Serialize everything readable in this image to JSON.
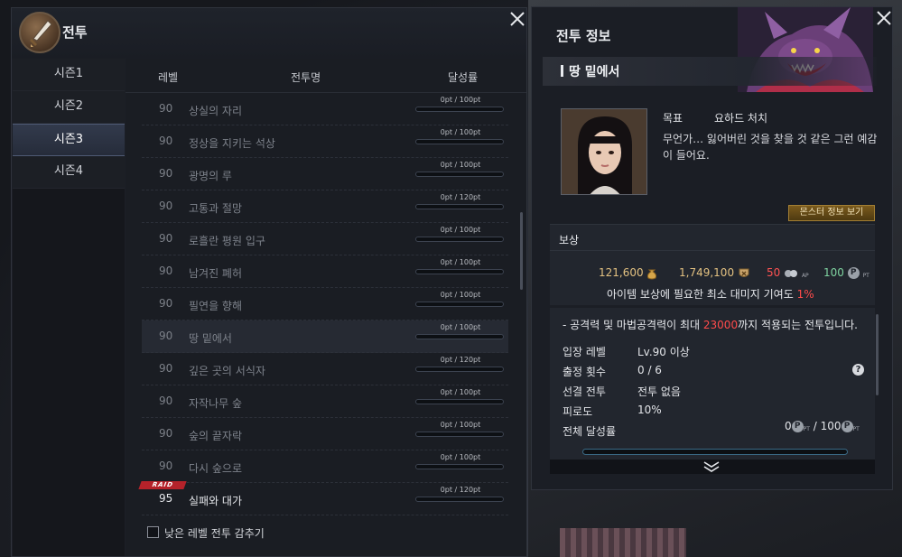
{
  "left_window": {
    "title": "전투",
    "seasons": [
      "시즌1",
      "시즌2",
      "시즌3",
      "시즌4"
    ],
    "active_season_index": 2,
    "columns": {
      "level": "레벨",
      "name": "전투명",
      "achievement": "달성률"
    },
    "rows": [
      {
        "level": "90",
        "name": "상실의 자리",
        "points": "0pt / 100pt",
        "progress": 0
      },
      {
        "level": "90",
        "name": "정상을 지키는 석상",
        "points": "0pt / 100pt",
        "progress": 0
      },
      {
        "level": "90",
        "name": "광명의 루",
        "points": "0pt / 100pt",
        "progress": 0
      },
      {
        "level": "90",
        "name": "고통과 절망",
        "points": "0pt / 120pt",
        "progress": 0
      },
      {
        "level": "90",
        "name": "로흘란 평원 입구",
        "points": "0pt / 100pt",
        "progress": 0
      },
      {
        "level": "90",
        "name": "남겨진 폐허",
        "points": "0pt / 100pt",
        "progress": 0
      },
      {
        "level": "90",
        "name": "필연을 향해",
        "points": "0pt / 100pt",
        "progress": 0
      },
      {
        "level": "90",
        "name": "땅 밑에서",
        "points": "0pt / 100pt",
        "progress": 0
      },
      {
        "level": "90",
        "name": "깊은 곳의 서식자",
        "points": "0pt / 120pt",
        "progress": 0
      },
      {
        "level": "90",
        "name": "자작나무 숲",
        "points": "0pt / 100pt",
        "progress": 0
      },
      {
        "level": "90",
        "name": "숲의 끝자락",
        "points": "0pt / 100pt",
        "progress": 0
      },
      {
        "level": "90",
        "name": "다시 숲으로",
        "points": "0pt / 100pt",
        "progress": 0
      },
      {
        "level": "95",
        "name": "실패와 대가",
        "points": "0pt / 120pt",
        "progress": 0,
        "badge": "RAID"
      }
    ],
    "selected_row_index": 7,
    "hide_low_level_label": "낮은 레벨 전투 감추기",
    "hide_low_level_checked": false
  },
  "right_window": {
    "title": "전투 정보",
    "battle_name": "땅 밑에서",
    "goal_label": "목표",
    "goal_value": "요하드 처치",
    "description": "무언가… 잃어버린 것을 찾을 것 같은 그런 예감이 들어요.",
    "monster_info_button": "몬스터 정보 보기",
    "reward": {
      "label": "보상",
      "gold": "121,600",
      "exp": "1,749,100",
      "ap": "50",
      "ap_unit": "AP",
      "pt": "100",
      "pt_unit": "PT",
      "note_prefix": "아이템 보상에 필요한 최소 대미지 기여도",
      "note_value": "1%"
    },
    "condition": {
      "prefix": "- 공격력 및 마법공격력이 최대",
      "value": "23000",
      "suffix": "까지 적용되는 전투입니다."
    },
    "info": [
      {
        "label": "입장 레벨",
        "value": "Lv.90 이상"
      },
      {
        "label": "출정 횟수",
        "value": "0 / 6"
      },
      {
        "label": "선결 전투",
        "value": "전투 없음"
      },
      {
        "label": "피로도",
        "value": "10%"
      },
      {
        "label": "전체 달성률",
        "value": ""
      }
    ],
    "total_points_current": "0",
    "total_points_max": "100",
    "total_points_unit": "PT",
    "total_progress": 0
  },
  "colors": {
    "accent_blue": "#4da3c7",
    "raid_red": "#b5222a",
    "highlight_red": "#ff4b4b",
    "gold": "#e3c181"
  }
}
